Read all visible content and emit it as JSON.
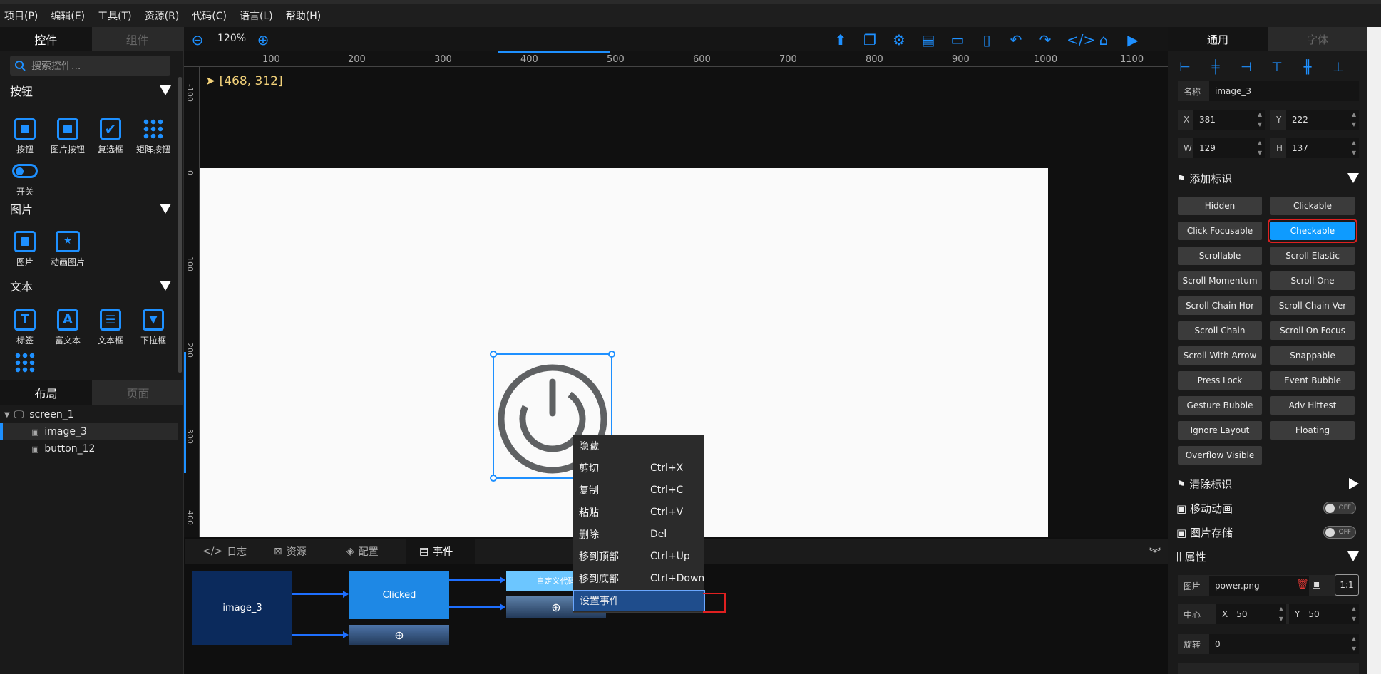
{
  "menu": [
    "项目(P)",
    "编辑(E)",
    "工具(T)",
    "资源(R)",
    "代码(C)",
    "语言(L)",
    "帮助(H)"
  ],
  "left": {
    "tabs": [
      "控件",
      "组件"
    ],
    "search_placeholder": "搜索控件...",
    "sections": {
      "buttons": {
        "title": "按钮",
        "items": [
          "按钮",
          "图片按钮",
          "复选框",
          "矩阵按钮",
          "开关"
        ]
      },
      "images": {
        "title": "图片",
        "items": [
          "图片",
          "动画图片"
        ]
      },
      "text": {
        "title": "文本",
        "items": [
          "标签",
          "富文本",
          "文本框",
          "下拉框"
        ]
      }
    },
    "layout_tabs": [
      "布局",
      "页面"
    ],
    "tree": [
      "screen_1",
      "image_3",
      "button_12"
    ]
  },
  "toolbar": {
    "zoom": "120%"
  },
  "ruler": {
    "h": [
      "100",
      "200",
      "300",
      "400",
      "500",
      "600",
      "700",
      "800",
      "900",
      "1000",
      "1100"
    ],
    "v": [
      "-100",
      "0",
      "100",
      "200",
      "300",
      "400"
    ]
  },
  "canvas": {
    "coord": "[468, 312]"
  },
  "bottom": {
    "tabs": [
      "日志",
      "资源",
      "配置",
      "事件"
    ],
    "nodes": {
      "source": "image_3",
      "event": "Clicked",
      "action": "自定义代码"
    }
  },
  "context_menu": [
    {
      "label": "隐藏",
      "key": ""
    },
    {
      "label": "剪切",
      "key": "Ctrl+X"
    },
    {
      "label": "复制",
      "key": "Ctrl+C"
    },
    {
      "label": "粘贴",
      "key": "Ctrl+V"
    },
    {
      "label": "删除",
      "key": "Del"
    },
    {
      "label": "移到顶部",
      "key": "Ctrl+Up"
    },
    {
      "label": "移到底部",
      "key": "Ctrl+Down"
    },
    {
      "label": "设置事件",
      "key": ""
    }
  ],
  "right": {
    "tabs": [
      "通用",
      "字体"
    ],
    "name_label": "名称",
    "name_value": "image_3",
    "x_label": "X",
    "x_value": "381",
    "y_label": "Y",
    "y_value": "222",
    "w_label": "W",
    "w_value": "129",
    "h_label": "H",
    "h_value": "137",
    "add_flags": "添加标识",
    "flags": [
      "Hidden",
      "Clickable",
      "Click Focusable",
      "Checkable",
      "Scrollable",
      "Scroll Elastic",
      "Scroll Momentum",
      "Scroll One",
      "Scroll Chain Hor",
      "Scroll Chain Ver",
      "Scroll Chain",
      "Scroll On Focus",
      "Scroll With Arrow",
      "Snappable",
      "Press Lock",
      "Event Bubble",
      "Gesture Bubble",
      "Adv Hittest",
      "Ignore Layout",
      "Floating",
      "Overflow Visible"
    ],
    "clear_flags": "清除标识",
    "move_anim": "移动动画",
    "img_store": "图片存储",
    "toggle_off": "OFF",
    "props": "属性",
    "img_label": "图片",
    "img_value": "power.png",
    "ratio": "1:1",
    "center_label": "中心",
    "cx_label": "X",
    "cx_value": "50",
    "cy_label": "Y",
    "cy_value": "50",
    "rotate_label": "旋转",
    "rotate_value": "0"
  }
}
